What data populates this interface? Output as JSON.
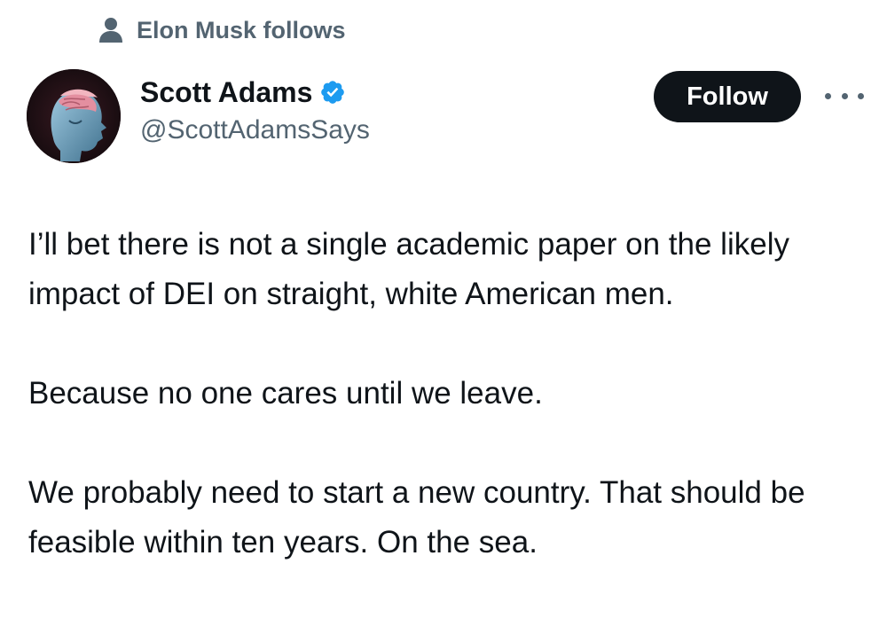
{
  "social_context": {
    "icon": "person-icon",
    "text": "Elon Musk follows"
  },
  "author": {
    "display_name": "Scott Adams",
    "verified": true,
    "verified_icon": "verified-badge-icon",
    "verified_color": "#1d9bf0",
    "handle": "@ScottAdamsSays",
    "avatar": "avatar-brain-head-image"
  },
  "actions": {
    "follow_label": "Follow",
    "more_icon": "more-options-icon"
  },
  "tweet": {
    "paragraphs": [
      "I’ll bet there is not a single academic paper on the likely impact of DEI on straight, white American men.",
      "Because no one cares until we leave.",
      "We probably need to start a new country. That should be feasible within ten years. On the sea."
    ]
  },
  "colors": {
    "text_primary": "#0f1419",
    "text_secondary": "#536471",
    "follow_button_bg": "#0f1419",
    "follow_button_text": "#ffffff"
  }
}
